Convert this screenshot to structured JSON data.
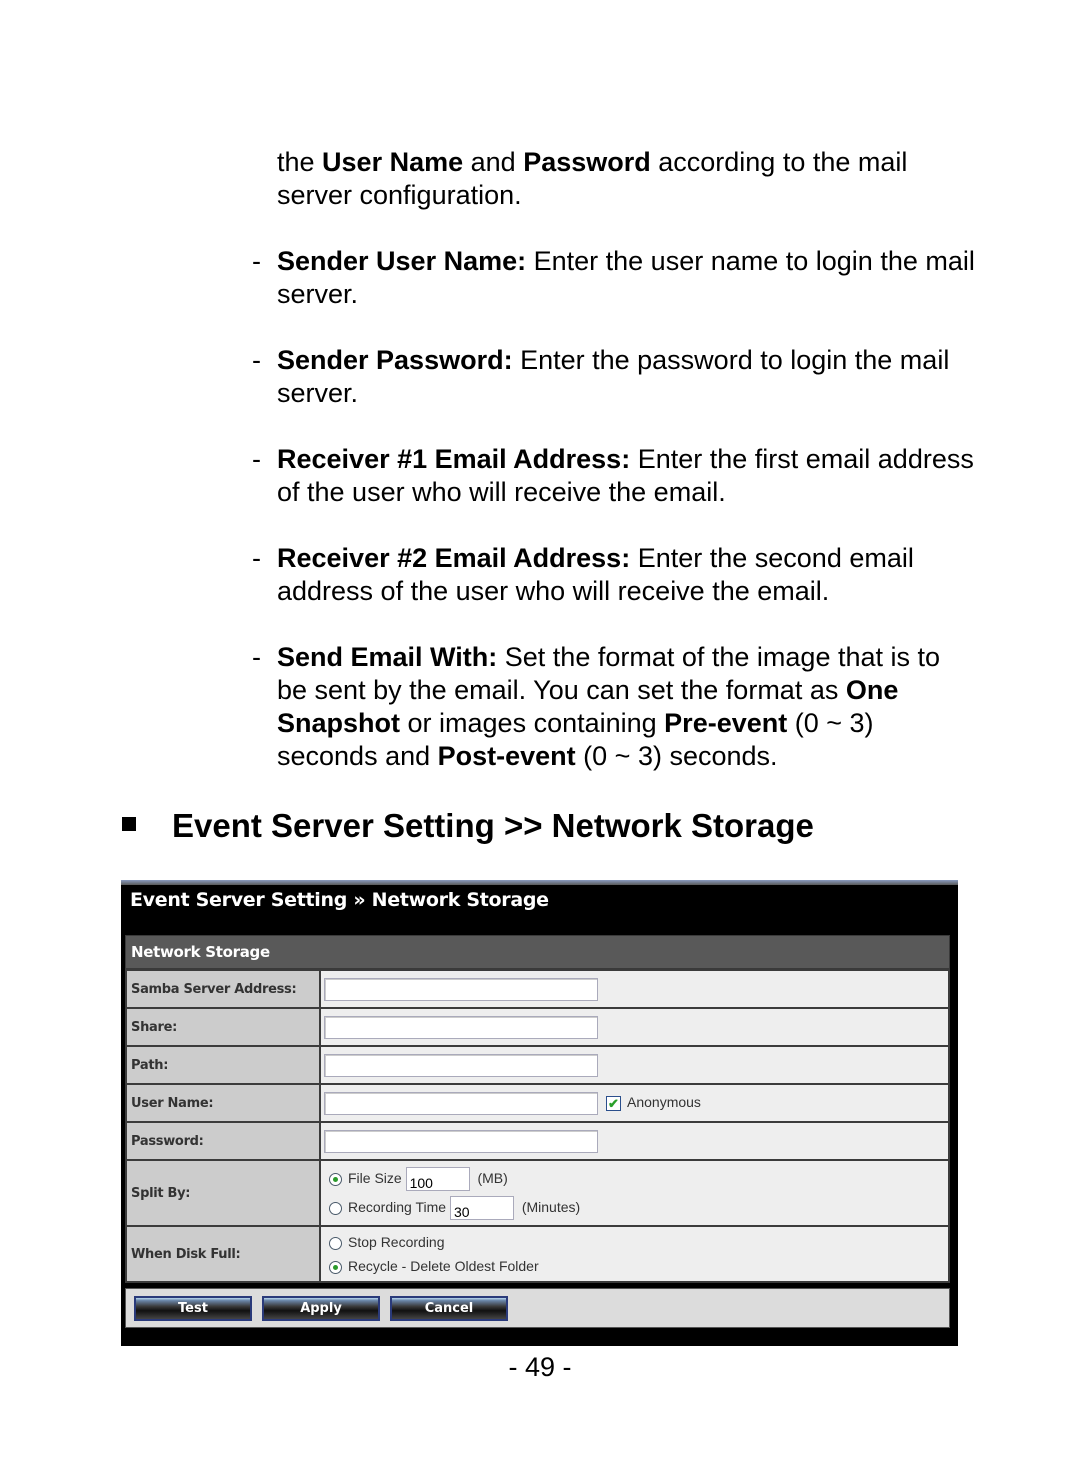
{
  "doc": {
    "intro": {
      "prefix": "the ",
      "bold1": "User Name",
      "mid": " and ",
      "bold2": "Password",
      "suffix": " according to the mail server configuration."
    },
    "items": [
      {
        "term": "Sender User Name:",
        "desc": " Enter the user name to login the mail server."
      },
      {
        "term": "Sender Password:",
        "desc": " Enter the password to login the mail server."
      },
      {
        "term": "Receiver #1 Email Address:",
        "desc": " Enter the first email address of the user who will receive the email."
      },
      {
        "term": "Receiver #2 Email Address:",
        "desc": " Enter the second email address of the user who will receive the email."
      }
    ],
    "send_email": {
      "term": "Send Email With:",
      "desc1": " Set the format of the image that is to be sent by the email. You can set the format as ",
      "b1": "One Snapshot",
      "desc2": " or images containing ",
      "b2": "Pre-event",
      "desc3": " (0 ~ 3) seconds and ",
      "b3": "Post-event",
      "desc4": " (0 ~ 3) seconds."
    },
    "dash": "-",
    "section_heading": "Event Server Setting >> Network Storage",
    "page_number": "- 49 -"
  },
  "ui": {
    "title": "Event Server Setting » Network Storage",
    "section": "Network Storage",
    "fields": {
      "samba_label": "Samba Server Address:",
      "samba_value": "",
      "share_label": "Share:",
      "share_value": "",
      "path_label": "Path:",
      "path_value": "",
      "username_label": "User Name:",
      "username_value": "",
      "anonymous_label": "Anonymous",
      "anonymous_checked": true,
      "password_label": "Password:",
      "password_value": "",
      "split_label": "Split By:",
      "split_filesize_label": "File Size",
      "split_filesize_value": "100",
      "split_filesize_unit": "(MB)",
      "split_time_label": "Recording Time",
      "split_time_value": "30",
      "split_time_unit": "(Minutes)",
      "split_selected": "File Size",
      "diskfull_label": "When Disk Full:",
      "diskfull_stop_label": "Stop Recording",
      "diskfull_recycle_label": "Recycle - Delete Oldest Folder",
      "diskfull_selected": "Recycle - Delete Oldest Folder"
    },
    "buttons": {
      "test": "Test",
      "apply": "Apply",
      "cancel": "Cancel"
    },
    "check_glyph": "✔"
  }
}
